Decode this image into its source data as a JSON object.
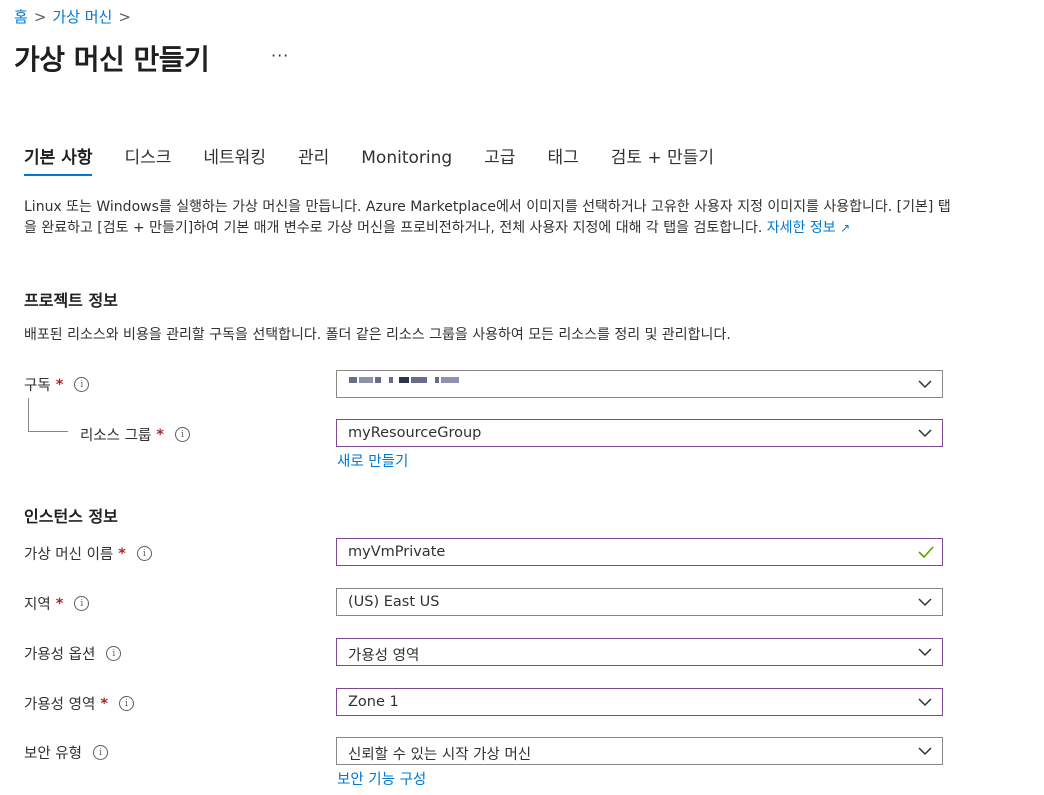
{
  "breadcrumb": {
    "items": [
      "홈",
      "가상 머신"
    ],
    "separator": ">"
  },
  "page": {
    "title": "가상 머신 만들기",
    "more": "···"
  },
  "tabs": [
    "기본 사항",
    "디스크",
    "네트워킹",
    "관리",
    "Monitoring",
    "고급",
    "태그",
    "검토 + 만들기"
  ],
  "active_tab": 0,
  "intro": {
    "text": "Linux 또는 Windows를 실행하는 가상 머신을 만듭니다. Azure Marketplace에서 이미지를 선택하거나 고유한 사용자 지정 이미지를 사용합니다. [기본] 탭을 완료하고 [검토 + 만들기]하여 기본 매개 변수로 가상 머신을 프로비전하거나, 전체 사용자 지정에 대해 각 탭을 검토합니다.",
    "link": "자세한 정보",
    "link_icon": "external-link-icon"
  },
  "project": {
    "heading": "프로젝트 정보",
    "description": "배포된 리소스와 비용을 관리할 구독을 선택합니다. 폴더 같은 리소스 그룹을 사용하여 모든 리소스를 정리 및 관리합니다.",
    "subscription": {
      "label": "구독",
      "required": "*",
      "value": ""
    },
    "resource_group": {
      "label": "리소스 그룹",
      "required": "*",
      "value": "myResourceGroup",
      "create_link": "새로 만들기"
    }
  },
  "instance": {
    "heading": "인스턴스 정보",
    "vm_name": {
      "label": "가상 머신 이름",
      "required": "*",
      "value": "myVmPrivate"
    },
    "region": {
      "label": "지역",
      "required": "*",
      "value": "(US) East US"
    },
    "availability_option": {
      "label": "가용성 옵션",
      "value": "가용성 영역"
    },
    "availability_zone": {
      "label": "가용성 영역",
      "required": "*",
      "value": "Zone 1"
    },
    "security_type": {
      "label": "보안 유형",
      "value": "신뢰할 수 있는 시작 가상 머신",
      "config_link": "보안 기능 구성"
    }
  },
  "colors": {
    "link": "#0078d4",
    "required": "#a4262c",
    "focus_border": "#7b4a91",
    "valid_check": "#57a300"
  }
}
